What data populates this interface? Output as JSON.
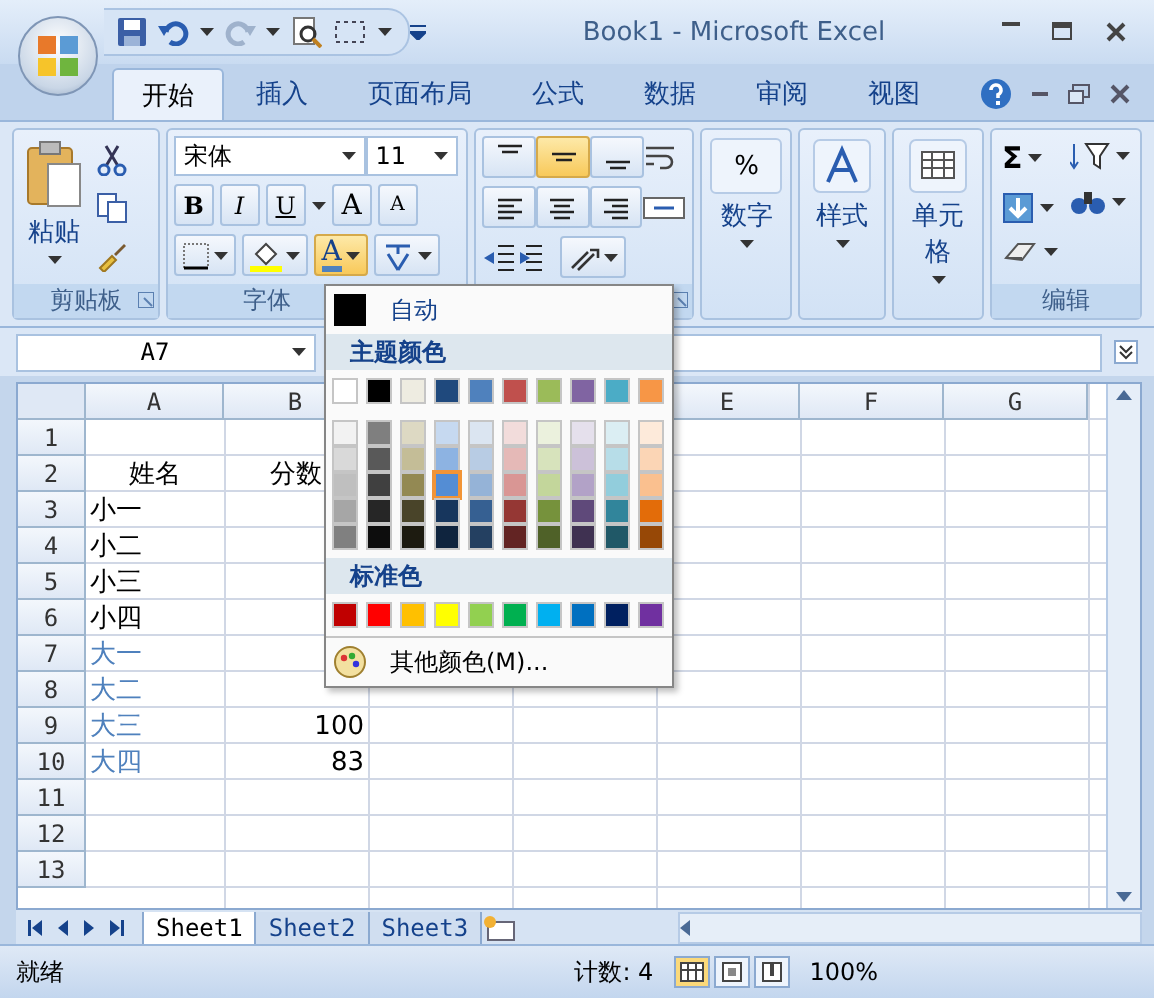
{
  "window": {
    "title": "Book1 - Microsoft Excel"
  },
  "ribbon_tabs": [
    {
      "label": "开始",
      "selected": true
    },
    {
      "label": "插入",
      "selected": false
    },
    {
      "label": "页面布局",
      "selected": false
    },
    {
      "label": "公式",
      "selected": false
    },
    {
      "label": "数据",
      "selected": false
    },
    {
      "label": "审阅",
      "selected": false
    },
    {
      "label": "视图",
      "selected": false
    }
  ],
  "ribbon": {
    "clipboard": {
      "paste": "粘贴",
      "label": "剪贴板"
    },
    "font": {
      "font_name": "宋体",
      "font_size": "11",
      "bold": "B",
      "italic": "I",
      "underline": "U",
      "grow": "A",
      "shrink": "A",
      "font_color": "A",
      "label": "字体"
    },
    "number": {
      "symbol": "%",
      "button": "数字"
    },
    "styles": {
      "button": "样式"
    },
    "cells": {
      "button": "单元格"
    },
    "editing": {
      "sum": "Σ",
      "label": "编辑"
    }
  },
  "formula_bar": {
    "name_box": "A7"
  },
  "sheet": {
    "columns": [
      {
        "label": "A"
      },
      {
        "label": "B"
      },
      {},
      {},
      {
        "label": "E"
      },
      {
        "label": "F"
      },
      {
        "label": "G"
      }
    ],
    "rows": [
      {
        "number": "1"
      },
      {
        "number": "2",
        "a": "姓名",
        "centered": true,
        "b": "分数"
      },
      {
        "number": "3",
        "a": "小一"
      },
      {
        "number": "4",
        "a": "小二"
      },
      {
        "number": "5",
        "a": "小三"
      },
      {
        "number": "6",
        "a": "小四"
      },
      {
        "number": "7",
        "a": "大一",
        "color": "#4f81bd"
      },
      {
        "number": "8",
        "a": "大二",
        "color": "#4f81bd"
      },
      {
        "number": "9",
        "a": "大三",
        "color": "#4f81bd",
        "b": "100"
      },
      {
        "number": "10",
        "a": "大四",
        "color": "#4f81bd",
        "b": "83"
      },
      {
        "number": "11"
      },
      {
        "number": "12"
      },
      {
        "number": "13"
      }
    ]
  },
  "font_color_menu": {
    "automatic": "自动",
    "theme_heading": "主题颜色",
    "theme_colors": [
      {
        "color": "#ffffff",
        "selected": false
      },
      {
        "color": "#000000",
        "selected": false
      },
      {
        "color": "#eeece1",
        "selected": false
      },
      {
        "color": "#1f497d",
        "selected": false
      },
      {
        "color": "#4f81bd",
        "selected": false
      },
      {
        "color": "#c0504d",
        "selected": false
      },
      {
        "color": "#9bbb59",
        "selected": false
      },
      {
        "color": "#8064a2",
        "selected": false
      },
      {
        "color": "#4bacc6",
        "selected": false
      },
      {
        "color": "#f79646",
        "selected": false
      }
    ],
    "shades": [
      [
        {
          "color": "#f2f2f2",
          "selected": false
        },
        {
          "color": "#7f7f7f",
          "selected": false
        },
        {
          "color": "#ddd9c3",
          "selected": false
        },
        {
          "color": "#c6d9f0",
          "selected": false
        },
        {
          "color": "#dbe5f1",
          "selected": false
        },
        {
          "color": "#f2dcdb",
          "selected": false
        },
        {
          "color": "#ebf1dd",
          "selected": false
        },
        {
          "color": "#e5e0ec",
          "selected": false
        },
        {
          "color": "#dbeef3",
          "selected": false
        },
        {
          "color": "#fdeada",
          "selected": false
        }
      ],
      [
        {
          "color": "#d9d9d9",
          "selected": false
        },
        {
          "color": "#595959",
          "selected": false
        },
        {
          "color": "#c4bd97",
          "selected": false
        },
        {
          "color": "#8db3e2",
          "selected": false
        },
        {
          "color": "#b8cce4",
          "selected": false
        },
        {
          "color": "#e5b9b7",
          "selected": false
        },
        {
          "color": "#d7e3bc",
          "selected": false
        },
        {
          "color": "#ccc1d9",
          "selected": false
        },
        {
          "color": "#b7dde8",
          "selected": false
        },
        {
          "color": "#fbd5b5",
          "selected": false
        }
      ],
      [
        {
          "color": "#bfbfbf",
          "selected": false
        },
        {
          "color": "#404040",
          "selected": false
        },
        {
          "color": "#938953",
          "selected": false
        },
        {
          "color": "#548dd4",
          "selected": true
        },
        {
          "color": "#95b3d7",
          "selected": false
        },
        {
          "color": "#d99694",
          "selected": false
        },
        {
          "color": "#c3d69b",
          "selected": false
        },
        {
          "color": "#b2a2c7",
          "selected": false
        },
        {
          "color": "#92cddc",
          "selected": false
        },
        {
          "color": "#fac08f",
          "selected": false
        }
      ],
      [
        {
          "color": "#a6a6a6",
          "selected": false
        },
        {
          "color": "#262626",
          "selected": false
        },
        {
          "color": "#494429",
          "selected": false
        },
        {
          "color": "#17365d",
          "selected": false
        },
        {
          "color": "#366092",
          "selected": false
        },
        {
          "color": "#953734",
          "selected": false
        },
        {
          "color": "#76923c",
          "selected": false
        },
        {
          "color": "#5f497a",
          "selected": false
        },
        {
          "color": "#31859b",
          "selected": false
        },
        {
          "color": "#e36c09",
          "selected": false
        }
      ],
      [
        {
          "color": "#808080",
          "selected": false
        },
        {
          "color": "#0d0d0d",
          "selected": false
        },
        {
          "color": "#1d1b10",
          "selected": false
        },
        {
          "color": "#0f243e",
          "selected": false
        },
        {
          "color": "#244061",
          "selected": false
        },
        {
          "color": "#632423",
          "selected": false
        },
        {
          "color": "#4f6128",
          "selected": false
        },
        {
          "color": "#3f3151",
          "selected": false
        },
        {
          "color": "#205867",
          "selected": false
        },
        {
          "color": "#974806",
          "selected": false
        }
      ]
    ],
    "standard_heading": "标准色",
    "standard_colors": [
      {
        "color": "#c00000",
        "selected": false
      },
      {
        "color": "#ff0000",
        "selected": false
      },
      {
        "color": "#ffc000",
        "selected": false
      },
      {
        "color": "#ffff00",
        "selected": false
      },
      {
        "color": "#92d050",
        "selected": false
      },
      {
        "color": "#00b050",
        "selected": false
      },
      {
        "color": "#00b0f0",
        "selected": false
      },
      {
        "color": "#0070c0",
        "selected": false
      },
      {
        "color": "#002060",
        "selected": false
      },
      {
        "color": "#7030a0",
        "selected": false
      }
    ],
    "more_colors": "其他颜色(M)..."
  },
  "sheet_tabs": [
    {
      "label": "Sheet1",
      "selected": true
    },
    {
      "label": "Sheet2",
      "selected": false
    },
    {
      "label": "Sheet3",
      "selected": false
    }
  ],
  "status_bar": {
    "status": "就绪",
    "count": "计数: 4",
    "zoom": "100%"
  }
}
